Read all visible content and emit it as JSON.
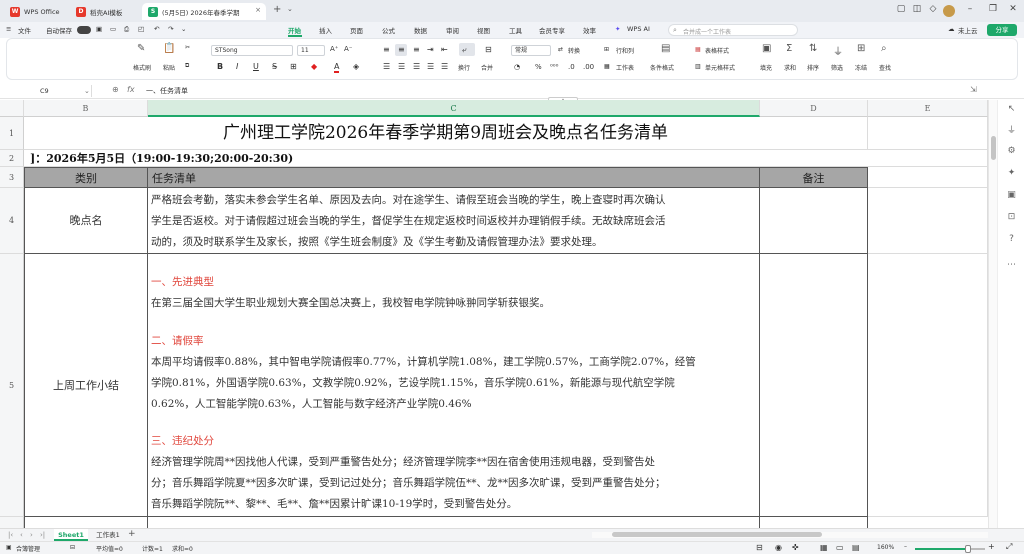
{
  "titlebar": {
    "tabs": [
      {
        "label": "WPS Office",
        "icon": "wps-logo-icon",
        "color": "#e6392c"
      },
      {
        "label": "稻壳AI模板",
        "icon": "docer-logo-icon",
        "color": "#e6392c"
      },
      {
        "label": "(5月5日) 2026年春季学期",
        "icon": "spreadsheet-icon",
        "color": "#1ea86a"
      }
    ],
    "new_tab": "+"
  },
  "menubar": {
    "file": "文件",
    "autosave": "自动保存",
    "menus": [
      "开始",
      "插入",
      "页面",
      "公式",
      "数据",
      "审阅",
      "视图",
      "工具",
      "会员专享",
      "效率"
    ],
    "active_menu": "开始",
    "wps_ai": "WPS AI",
    "search_placeholder": "合并成一个工作表",
    "cloud": "未上云",
    "share": "分享"
  },
  "ribbon": {
    "format_painter": "格式刷",
    "paste": "粘贴",
    "font_name": "STSong",
    "font_size": "11",
    "number_format": "常规",
    "convert": "转换",
    "wrap": "换行",
    "merge": "合并",
    "row_col": "行和列",
    "worksheet": "工作表",
    "cond_format": "条件格式",
    "table_style": "表格样式",
    "cell_style": "单元格样式",
    "fill": "填充",
    "sum": "求和",
    "sort": "排序",
    "filter": "筛选",
    "freeze": "冻结",
    "find": "查找"
  },
  "formula_bar": {
    "cell_ref": "C9",
    "content": "一、任务清单"
  },
  "columns": [
    "B",
    "C",
    "D",
    "E"
  ],
  "rows": [
    "1",
    "2",
    "3",
    "4",
    "5"
  ],
  "sheet": {
    "title": "广州理工学院2026年春季学期第9周班会及晚点名任务清单",
    "date_line": "]：2026年5月5日（19:00-19:30;20:00-20:30)",
    "header": {
      "category": "类别",
      "tasks": "任务清单",
      "notes": "备注"
    },
    "row4": {
      "category": "晚点名",
      "lines": [
        "严格班会考勤，落实未参会学生名单、原因及去向。对在途学生、请假至班会当晚的学生，晚上查寝时再次确认",
        "学生是否返校。对于请假超过班会当晚的学生，督促学生在规定返校时间返校并办理销假手续。无故缺席班会活",
        "动的，须及时联系学生及家长，按照《学生班会制度》及《学生考勤及请假管理办法》要求处理。"
      ]
    },
    "row5": {
      "category": "上周工作小结",
      "s1_title": "一、先进典型",
      "s1_lines": [
        "    在第三届全国大学生职业规划大赛全国总决赛上，我校智电学院钟咏翀同学斩获银奖。"
      ],
      "s2_title": "二、请假率",
      "s2_lines": [
        "   本周平均请假率0.88%，其中智电学院请假率0.77%，计算机学院1.08%，建工学院0.57%，工商学院2.07%，经管",
        "学院0.81%，外国语学院0.63%，文教学院0.92%，艺设学院1.15%，音乐学院0.61%，新能源与现代航空学院",
        "0.62%，人工智能学院0.63%，人工智能与数字经济产业学院0.46%"
      ],
      "s3_title": "三、违纪处分",
      "s3_lines": [
        "   经济管理学院周**因找他人代课，受到严重警告处分；经济管理学院李**因在宿舍使用违规电器，受到警告处",
        "分；音乐舞蹈学院夏**因多次旷课，受到记过处分；音乐舞蹈学院伍**、龙**因多次旷课，受到严重警告处分；",
        "音乐舞蹈学院阮**、黎**、毛**、詹**因累计旷课10-19学时，受到警告处分。"
      ]
    }
  },
  "sheet_tabs": [
    "Sheet1",
    "工作表1"
  ],
  "active_sheet": "Sheet1",
  "add_sheet": "+",
  "statusbar": {
    "book_manager": "合簿管理",
    "average": "平均值=0",
    "count": "计数=1",
    "sum": "求和=0",
    "zoom": "160%"
  },
  "colors": {
    "accent_green": "#1ea86a",
    "header_gray": "#a6a6a6",
    "red_heading": "#e0463c",
    "selected_col": "#c9e9d5"
  }
}
